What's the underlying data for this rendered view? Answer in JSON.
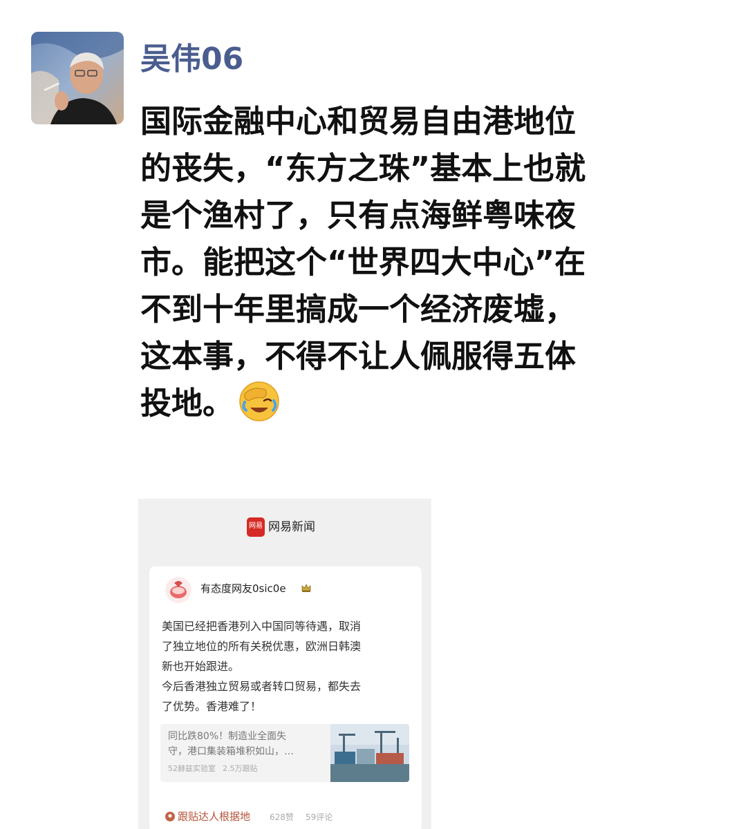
{
  "post": {
    "author": "吴伟06",
    "avatar_icon": "avatar-photo",
    "text_lines": [
      "国际金融中心和贸易自由港地位",
      "的丧失，“东方之珠”基本上也就",
      "是个渔村了，只有点海鲜粤味夜",
      "市。能把这个“世界四大中心”在",
      "不到十年里搞成一个经济废墟，",
      "这本事，不得不让人佩服得五体",
      "投地。"
    ],
    "emoji_icon": "face-palm-laughing-icon"
  },
  "embedded": {
    "brand_logo_text": "网易",
    "brand_name": "网易新闻",
    "commenter": {
      "name": "有态度网友0sic0e",
      "badge_icon": "crown-icon"
    },
    "comment_lines": [
      "美国已经把香港列入中国同等待遇，取消",
      "了独立地位的所有关税优惠，欧洲日韩澳",
      "新也开始跟进。",
      "今后香港独立贸易或者转口贸易，都失去",
      "了优势。香港难了！"
    ],
    "link": {
      "title_lines": [
        "同比跌80%！制造业全面失",
        "守，港口集装箱堆积如山，…"
      ],
      "source": "52赫兹实验室",
      "replies": "2.5万跟贴"
    },
    "footer": {
      "source": "跟贴达人根据地",
      "likes": "628赞",
      "comments": "59评论"
    }
  },
  "colors": {
    "author": "#4a5d8f",
    "brand_red": "#d62b25",
    "footer_source": "#b4533a"
  }
}
